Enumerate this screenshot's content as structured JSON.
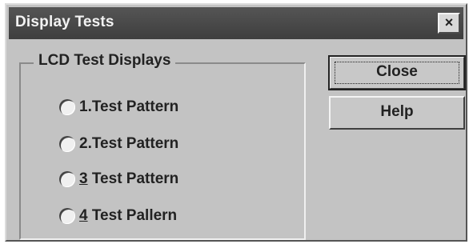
{
  "window": {
    "title": "Display Tests",
    "close_glyph": "×"
  },
  "group": {
    "label": "LCD Test Displays",
    "options": [
      {
        "num": "1",
        "sep": ".",
        "text": "Test Pattern",
        "underlined": false
      },
      {
        "num": "2",
        "sep": ".",
        "text": "Test Pattern",
        "underlined": false
      },
      {
        "num": "3",
        "sep": " ",
        "text": "Test Pattern",
        "underlined": true
      },
      {
        "num": "4",
        "sep": " ",
        "text": "Test Pallern",
        "underlined": true
      }
    ]
  },
  "buttons": {
    "close_label": "Close",
    "help_label": "Help"
  }
}
